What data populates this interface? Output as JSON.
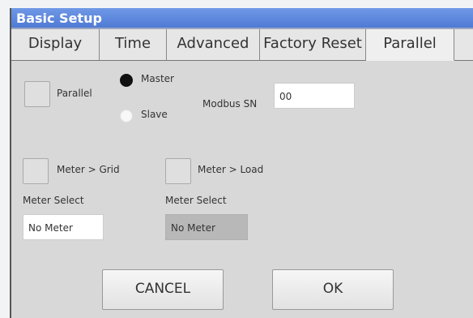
{
  "window": {
    "title": "Basic Setup"
  },
  "tabs": [
    {
      "label": "Display"
    },
    {
      "label": "Time"
    },
    {
      "label": "Advanced"
    },
    {
      "label": "Factory Reset"
    },
    {
      "label": "Parallel"
    }
  ],
  "active_tab": "Parallel",
  "parallel": {
    "label": "Parallel",
    "checked": false,
    "mode_options": [
      {
        "label": "Master",
        "selected": true
      },
      {
        "label": "Slave",
        "selected": false
      }
    ]
  },
  "modbus": {
    "label": "Modbus SN",
    "value": "00"
  },
  "meter_grid": {
    "label": "Meter > Grid",
    "checked": false,
    "select_label": "Meter Select",
    "select_value": "No Meter"
  },
  "meter_load": {
    "label": "Meter > Load",
    "checked": false,
    "select_label": "Meter Select",
    "select_value": "No Meter",
    "disabled": true
  },
  "buttons": {
    "cancel": "CANCEL",
    "ok": "OK"
  }
}
